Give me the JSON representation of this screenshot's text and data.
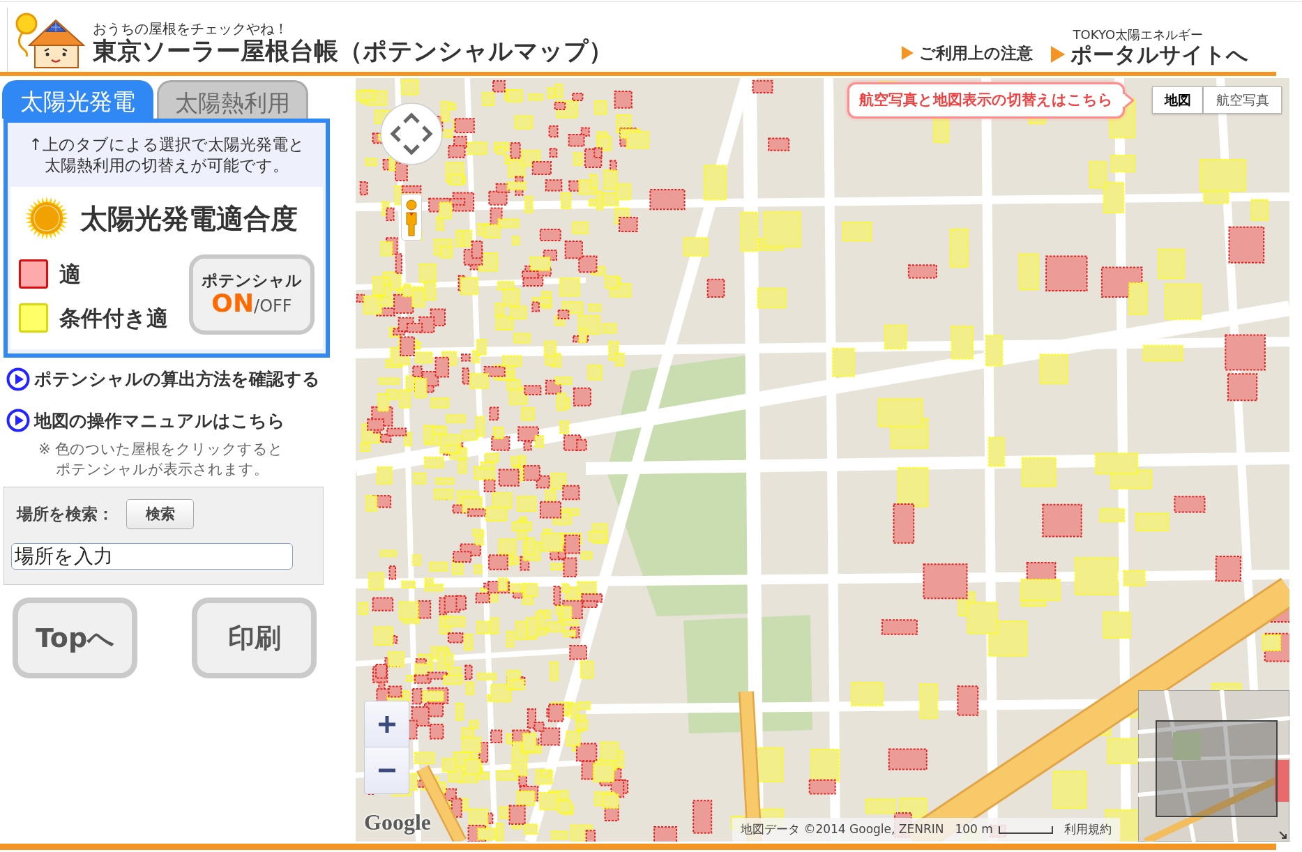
{
  "header": {
    "tagline": "おうちの屋根をチェックやね！",
    "title": "東京ソーラー屋根台帳（ポテンシャルマップ）",
    "links": [
      {
        "kind": "notice",
        "label": "ご利用上の注意"
      },
      {
        "kind": "portal",
        "caption": "TOKYO太陽エネルギー",
        "label": "ポータルサイトへ"
      }
    ]
  },
  "tabs": [
    {
      "label": "太陽光発電",
      "selected": true
    },
    {
      "label": "太陽熱利用",
      "selected": false
    }
  ],
  "tab_note": "↑上のタブによる選択で太陽光発電と太陽熱利用の切替えが可能です。",
  "legend": {
    "title": "太陽光発電適合度",
    "items": [
      {
        "label": "適",
        "color": "#ffaaaa"
      },
      {
        "label": "条件付き適",
        "color": "#ffff66"
      }
    ]
  },
  "potential_toggle": {
    "label": "ポテンシャル",
    "on_text": "ON",
    "separator": "/",
    "off_text": "OFF",
    "on": true
  },
  "info_links": [
    {
      "label": "ポテンシャルの算出方法を確認する"
    },
    {
      "label": "地図の操作マニュアルはこちら"
    }
  ],
  "click_note": "※ 色のついた屋根をクリックするとポテンシャルが表示されます。",
  "search": {
    "label": "場所を検索：",
    "button": "検索",
    "placeholder": "場所を入力"
  },
  "actions": [
    {
      "label": "Topへ"
    },
    {
      "label": "印刷"
    }
  ],
  "map": {
    "callout": "航空写真と地図表示の切替えはこちら",
    "map_types": [
      {
        "label": "地図",
        "selected": true
      },
      {
        "label": "航空写真",
        "selected": false
      }
    ],
    "logo": "Google",
    "attribution": "地図データ ©2014 Google, ZENRIN",
    "scale": "100 m",
    "terms": "利用規約"
  }
}
